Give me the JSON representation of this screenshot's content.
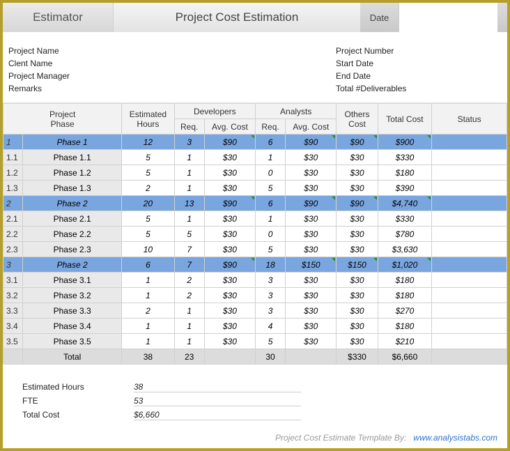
{
  "header": {
    "estimator": "Estimator",
    "title": "Project Cost Estimation",
    "date_label": "Date"
  },
  "meta": {
    "left": {
      "project_name": "Project Name",
      "client_name": "Clent Name",
      "project_manager": "Project Manager",
      "remarks": "Remarks"
    },
    "right": {
      "project_number": "Project Number",
      "start_date": "Start Date",
      "end_date": "End Date",
      "total_deliverables": "Total #Deliverables"
    }
  },
  "columns": {
    "project": "Project",
    "phase": "Phase",
    "estimated": "Estimated",
    "hours": "Hours",
    "developers": "Developers",
    "analysts": "Analysts",
    "others": "Others",
    "others_cost": "Cost",
    "req": "Req.",
    "avg_cost": "Avg. Cost",
    "total_cost": "Total Cost",
    "status": "Status"
  },
  "rows": [
    {
      "hilite": true,
      "idx": "1",
      "phase": "Phase 1",
      "hours": "12",
      "dev_req": "3",
      "dev_avg": "$90",
      "an_req": "6",
      "an_avg": "$90",
      "oth": "$90",
      "total": "$900"
    },
    {
      "hilite": false,
      "idx": "1.1",
      "phase": "Phase 1.1",
      "hours": "5",
      "dev_req": "1",
      "dev_avg": "$30",
      "an_req": "1",
      "an_avg": "$30",
      "oth": "$30",
      "total": "$330"
    },
    {
      "hilite": false,
      "idx": "1.2",
      "phase": "Phase 1.2",
      "hours": "5",
      "dev_req": "1",
      "dev_avg": "$30",
      "an_req": "0",
      "an_avg": "$30",
      "oth": "$30",
      "total": "$180"
    },
    {
      "hilite": false,
      "idx": "1.3",
      "phase": "Phase 1.3",
      "hours": "2",
      "dev_req": "1",
      "dev_avg": "$30",
      "an_req": "5",
      "an_avg": "$30",
      "oth": "$30",
      "total": "$390"
    },
    {
      "hilite": true,
      "idx": "2",
      "phase": "Phase 2",
      "hours": "20",
      "dev_req": "13",
      "dev_avg": "$90",
      "an_req": "6",
      "an_avg": "$90",
      "oth": "$90",
      "total": "$4,740"
    },
    {
      "hilite": false,
      "idx": "2.1",
      "phase": "Phase 2.1",
      "hours": "5",
      "dev_req": "1",
      "dev_avg": "$30",
      "an_req": "1",
      "an_avg": "$30",
      "oth": "$30",
      "total": "$330"
    },
    {
      "hilite": false,
      "idx": "2.2",
      "phase": "Phase 2.2",
      "hours": "5",
      "dev_req": "5",
      "dev_avg": "$30",
      "an_req": "0",
      "an_avg": "$30",
      "oth": "$30",
      "total": "$780"
    },
    {
      "hilite": false,
      "idx": "2.3",
      "phase": "Phase 2.3",
      "hours": "10",
      "dev_req": "7",
      "dev_avg": "$30",
      "an_req": "5",
      "an_avg": "$30",
      "oth": "$30",
      "total": "$3,630"
    },
    {
      "hilite": true,
      "idx": "3",
      "phase": "Phase 2",
      "hours": "6",
      "dev_req": "7",
      "dev_avg": "$90",
      "an_req": "18",
      "an_avg": "$150",
      "oth": "$150",
      "total": "$1,020"
    },
    {
      "hilite": false,
      "idx": "3.1",
      "phase": "Phase 3.1",
      "hours": "1",
      "dev_req": "2",
      "dev_avg": "$30",
      "an_req": "3",
      "an_avg": "$30",
      "oth": "$30",
      "total": "$180"
    },
    {
      "hilite": false,
      "idx": "3.2",
      "phase": "Phase 3.2",
      "hours": "1",
      "dev_req": "2",
      "dev_avg": "$30",
      "an_req": "3",
      "an_avg": "$30",
      "oth": "$30",
      "total": "$180"
    },
    {
      "hilite": false,
      "idx": "3.3",
      "phase": "Phase 3.3",
      "hours": "2",
      "dev_req": "1",
      "dev_avg": "$30",
      "an_req": "3",
      "an_avg": "$30",
      "oth": "$30",
      "total": "$270"
    },
    {
      "hilite": false,
      "idx": "3.4",
      "phase": "Phase 3.4",
      "hours": "1",
      "dev_req": "1",
      "dev_avg": "$30",
      "an_req": "4",
      "an_avg": "$30",
      "oth": "$30",
      "total": "$180"
    },
    {
      "hilite": false,
      "idx": "3.5",
      "phase": "Phase 3.5",
      "hours": "1",
      "dev_req": "1",
      "dev_avg": "$30",
      "an_req": "5",
      "an_avg": "$30",
      "oth": "$30",
      "total": "$210"
    }
  ],
  "totals": {
    "label": "Total",
    "hours": "38",
    "dev_req": "23",
    "an_req": "30",
    "oth": "$330",
    "total": "$6,660"
  },
  "summary": {
    "estimated_hours_label": "Estimated Hours",
    "estimated_hours": "38",
    "fte_label": "FTE",
    "fte": "53",
    "total_cost_label": "Total Cost",
    "total_cost": "$6,660"
  },
  "footer": {
    "text": "Project Cost Estimate Template By:",
    "link": "www.analysistabs.com"
  }
}
